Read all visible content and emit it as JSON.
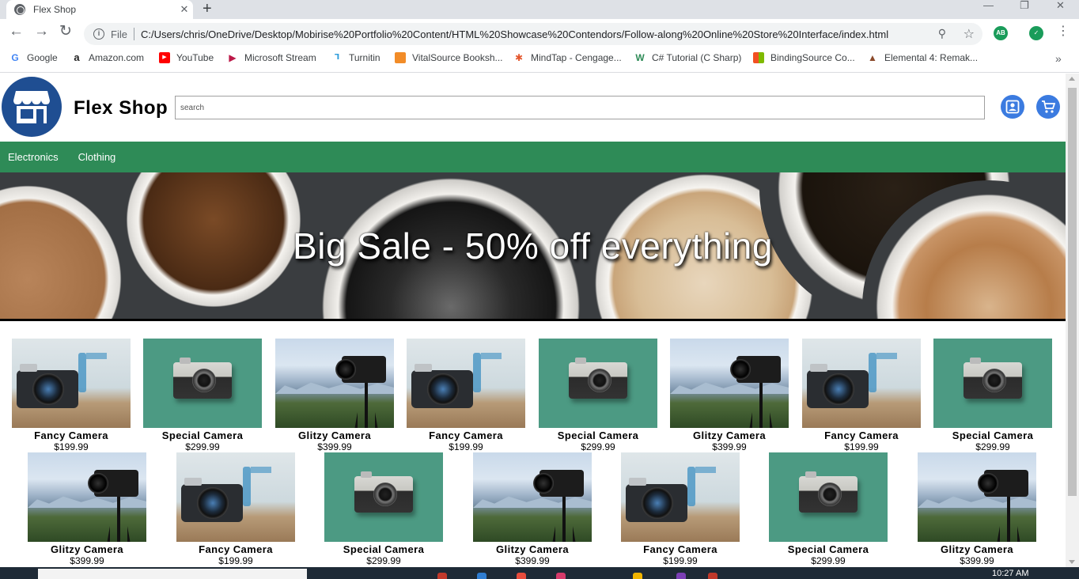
{
  "browser": {
    "tab_title": "Flex Shop",
    "tab_close": "✕",
    "new_tab": "+",
    "window_controls": [
      "—",
      "❐",
      "✕"
    ],
    "file_label": "File",
    "url": "C:/Users/chris/OneDrive/Desktop/Mobirise%20Portfolio%20Content/HTML%20Showcase%20Contendors/Follow-along%20Online%20Store%20Interface/index.html",
    "extensions": [
      {
        "name": "AB",
        "color": "#1a9c5a"
      },
      {
        "name": "",
        "color": "#1a9c5a"
      }
    ],
    "bookmarks": [
      {
        "label": "Google",
        "icon": "G",
        "color": "#4285f4"
      },
      {
        "label": "Amazon.com",
        "icon": "a",
        "color": "#222222"
      },
      {
        "label": "YouTube",
        "icon": "▶",
        "color": "#ff0000"
      },
      {
        "label": "Microsoft Stream",
        "icon": "▶",
        "color": "#bc1948"
      },
      {
        "label": "Turnitin",
        "icon": "T",
        "color": "#2d9cdb"
      },
      {
        "label": "VitalSource Booksh...",
        "icon": "V",
        "color": "#f28c28"
      },
      {
        "label": "MindTap - Cengage...",
        "icon": "✱",
        "color": "#e4572e"
      },
      {
        "label": "C# Tutorial (C Sharp)",
        "icon": "W",
        "color": "#2e8b57"
      },
      {
        "label": "BindingSource Co...",
        "icon": "▦",
        "color": "#f25022"
      },
      {
        "label": "Elemental 4: Remak...",
        "icon": "▲",
        "color": "#8b4a2b"
      }
    ],
    "more_bookmarks": "»"
  },
  "site": {
    "brand": "Flex Shop",
    "search_placeholder": "search",
    "nav": [
      "Electronics",
      "Clothing"
    ],
    "hero_text": "Big Sale - 50% off everything",
    "accent_color": "#2e8b57",
    "logo_color": "#1f4e92",
    "icon_button_color": "#3b7be0"
  },
  "products": [
    {
      "name": "Fancy Camera",
      "price": "$199.99",
      "style": "fancy"
    },
    {
      "name": "Special Camera",
      "price": "$299.99",
      "style": "special"
    },
    {
      "name": "Glitzy Camera",
      "price": "$399.99",
      "style": "glitzy"
    },
    {
      "name": "Fancy Camera",
      "price": "$199.99",
      "style": "fancy"
    },
    {
      "name": "Special Camera",
      "price": "$299.99",
      "style": "special"
    },
    {
      "name": "Glitzy Camera",
      "price": "$399.99",
      "style": "glitzy"
    },
    {
      "name": "Fancy Camera",
      "price": "$199.99",
      "style": "fancy"
    },
    {
      "name": "Special Camera",
      "price": "$299.99",
      "style": "special"
    },
    {
      "name": "Glitzy Camera",
      "price": "$399.99",
      "style": "glitzy"
    },
    {
      "name": "Fancy Camera",
      "price": "$199.99",
      "style": "fancy"
    },
    {
      "name": "Special Camera",
      "price": "$299.99",
      "style": "special"
    },
    {
      "name": "Glitzy Camera",
      "price": "$399.99",
      "style": "glitzy"
    },
    {
      "name": "Fancy Camera",
      "price": "$199.99",
      "style": "fancy"
    },
    {
      "name": "Special Camera",
      "price": "$299.99",
      "style": "special"
    },
    {
      "name": "Glitzy Camera",
      "price": "$399.99",
      "style": "glitzy"
    }
  ],
  "taskbar": {
    "clock": "10:27 AM"
  }
}
